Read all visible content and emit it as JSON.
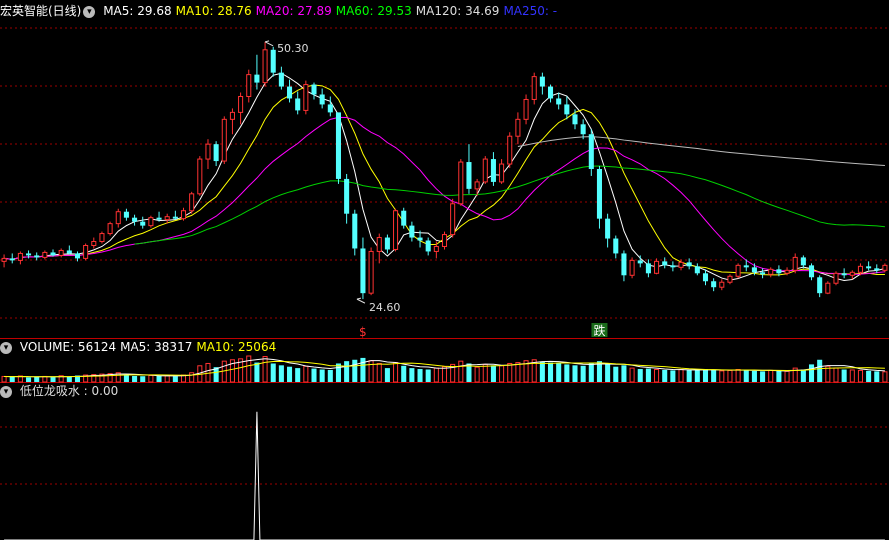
{
  "stock": {
    "title": "宏英智能(日线)"
  },
  "price_panel": {
    "indicators": [
      {
        "label": "MA5: 29.68",
        "color": "#ffffff"
      },
      {
        "label": "MA10: 28.76",
        "color": "#ffff00"
      },
      {
        "label": "MA20: 27.89",
        "color": "#ff00ff"
      },
      {
        "label": "MA60: 29.53",
        "color": "#00ff00"
      },
      {
        "label": "MA120: 34.69",
        "color": "#dddddd"
      },
      {
        "label": "MA250: -",
        "color": "#3333ff"
      }
    ],
    "high_marker": "50.30",
    "low_marker": "24.60",
    "signal_buy": "$",
    "signal_fall": "跌"
  },
  "volume_panel": {
    "indicators": [
      {
        "label": "VOLUME: 56124",
        "color": "#ffffff"
      },
      {
        "label": "MA5: 38317",
        "color": "#ffffff"
      },
      {
        "label": "MA10: 25064",
        "color": "#ffff00"
      }
    ]
  },
  "signal_panel": {
    "indicators": [
      {
        "label": "低位龙吸水 : 0.00",
        "color": "#dddddd"
      }
    ]
  },
  "colors": {
    "up": "#ff3232",
    "down": "#54ffff",
    "grid": "#9b0000"
  },
  "chart_data": {
    "type": "candlestick",
    "ohlc": [
      [
        28.2,
        28.9,
        27.6,
        28.5
      ],
      [
        28.5,
        29.0,
        28.0,
        28.3
      ],
      [
        28.3,
        29.2,
        27.9,
        29.0
      ],
      [
        29.0,
        29.3,
        28.5,
        28.8
      ],
      [
        28.8,
        29.1,
        28.3,
        28.6
      ],
      [
        28.6,
        29.3,
        28.4,
        29.1
      ],
      [
        29.1,
        29.4,
        28.7,
        28.8
      ],
      [
        28.8,
        29.5,
        28.6,
        29.3
      ],
      [
        29.3,
        29.8,
        28.9,
        29.0
      ],
      [
        29.0,
        29.2,
        28.2,
        28.5
      ],
      [
        28.5,
        30.0,
        28.3,
        29.8
      ],
      [
        29.8,
        30.6,
        29.5,
        30.2
      ],
      [
        30.2,
        31.2,
        30.0,
        31.0
      ],
      [
        31.0,
        32.2,
        30.8,
        32.0
      ],
      [
        32.0,
        33.5,
        31.6,
        33.2
      ],
      [
        33.2,
        33.5,
        32.3,
        32.6
      ],
      [
        32.6,
        32.9,
        31.8,
        32.2
      ],
      [
        32.2,
        32.7,
        31.5,
        31.8
      ],
      [
        31.8,
        32.8,
        31.6,
        32.6
      ],
      [
        32.6,
        33.2,
        32.2,
        32.4
      ],
      [
        32.4,
        33.0,
        32.0,
        32.7
      ],
      [
        32.7,
        33.3,
        32.4,
        32.5
      ],
      [
        32.5,
        33.6,
        32.3,
        33.3
      ],
      [
        33.3,
        35.2,
        33.0,
        35.0
      ],
      [
        35.0,
        38.8,
        34.8,
        38.5
      ],
      [
        38.5,
        40.5,
        37.5,
        40.0
      ],
      [
        40.0,
        40.3,
        37.8,
        38.3
      ],
      [
        38.3,
        42.8,
        38.0,
        42.5
      ],
      [
        42.5,
        43.6,
        41.0,
        43.2
      ],
      [
        43.2,
        45.2,
        42.0,
        44.8
      ],
      [
        44.8,
        47.5,
        44.2,
        47.0
      ],
      [
        47.0,
        49.0,
        45.5,
        46.2
      ],
      [
        46.2,
        50.3,
        45.8,
        49.5
      ],
      [
        49.5,
        49.8,
        46.8,
        47.2
      ],
      [
        47.2,
        47.8,
        45.5,
        45.8
      ],
      [
        45.8,
        46.5,
        44.2,
        44.6
      ],
      [
        44.6,
        45.3,
        43.0,
        43.4
      ],
      [
        43.4,
        46.4,
        43.0,
        46.0
      ],
      [
        46.0,
        46.2,
        44.5,
        45.0
      ],
      [
        45.0,
        45.6,
        43.6,
        44.0
      ],
      [
        44.0,
        44.8,
        42.8,
        43.2
      ],
      [
        43.2,
        39.5,
        36.0,
        36.5
      ],
      [
        36.5,
        37.0,
        32.0,
        33.0
      ],
      [
        33.0,
        33.4,
        28.8,
        29.5
      ],
      [
        29.5,
        30.6,
        24.4,
        25.0
      ],
      [
        25.0,
        29.6,
        24.8,
        29.2
      ],
      [
        29.2,
        31.0,
        28.0,
        30.6
      ],
      [
        30.6,
        30.9,
        29.0,
        29.4
      ],
      [
        29.4,
        33.5,
        29.2,
        33.3
      ],
      [
        33.3,
        33.6,
        31.5,
        31.8
      ],
      [
        31.8,
        32.2,
        30.2,
        30.6
      ],
      [
        30.6,
        31.3,
        29.6,
        30.3
      ],
      [
        30.3,
        30.6,
        28.8,
        29.2
      ],
      [
        29.2,
        30.2,
        28.5,
        29.7
      ],
      [
        29.7,
        31.2,
        29.4,
        30.9
      ],
      [
        30.9,
        34.5,
        30.6,
        34.0
      ],
      [
        34.0,
        38.5,
        33.8,
        38.2
      ],
      [
        38.2,
        40.0,
        35.0,
        35.5
      ],
      [
        35.5,
        36.5,
        34.8,
        36.2
      ],
      [
        36.2,
        38.8,
        36.0,
        38.5
      ],
      [
        38.5,
        39.2,
        35.8,
        36.2
      ],
      [
        36.2,
        38.5,
        36.0,
        38.0
      ],
      [
        38.0,
        41.2,
        37.6,
        40.8
      ],
      [
        40.8,
        43.2,
        40.0,
        42.5
      ],
      [
        42.5,
        45.0,
        42.0,
        44.5
      ],
      [
        44.5,
        47.2,
        44.0,
        46.8
      ],
      [
        46.8,
        47.2,
        45.0,
        45.8
      ],
      [
        45.8,
        46.0,
        44.2,
        44.6
      ],
      [
        44.6,
        45.2,
        43.5,
        44.0
      ],
      [
        44.0,
        44.8,
        42.5,
        43.0
      ],
      [
        43.0,
        43.5,
        41.5,
        42.0
      ],
      [
        42.0,
        42.5,
        40.5,
        41.0
      ],
      [
        41.0,
        41.5,
        36.8,
        37.5
      ],
      [
        37.5,
        37.8,
        31.5,
        32.5
      ],
      [
        32.5,
        33.0,
        29.6,
        30.5
      ],
      [
        30.5,
        30.8,
        28.5,
        29.0
      ],
      [
        29.0,
        29.3,
        26.2,
        26.8
      ],
      [
        26.8,
        28.6,
        26.5,
        28.3
      ],
      [
        28.3,
        28.8,
        27.6,
        28.0
      ],
      [
        28.0,
        28.4,
        26.6,
        27.0
      ],
      [
        27.0,
        28.5,
        26.9,
        28.2
      ],
      [
        28.2,
        28.6,
        27.5,
        27.8
      ],
      [
        27.8,
        28.2,
        27.2,
        27.6
      ],
      [
        27.6,
        28.4,
        27.3,
        28.1
      ],
      [
        28.1,
        28.5,
        27.4,
        27.7
      ],
      [
        27.7,
        28.0,
        26.8,
        27.0
      ],
      [
        27.0,
        27.4,
        25.8,
        26.2
      ],
      [
        26.2,
        26.5,
        25.2,
        25.6
      ],
      [
        25.6,
        26.4,
        25.3,
        26.1
      ],
      [
        26.1,
        26.9,
        25.9,
        26.7
      ],
      [
        26.7,
        28.0,
        26.5,
        27.8
      ],
      [
        27.8,
        28.4,
        27.2,
        27.6
      ],
      [
        27.6,
        28.0,
        26.8,
        27.1
      ],
      [
        27.1,
        27.5,
        26.5,
        26.9
      ],
      [
        26.9,
        27.6,
        26.6,
        27.4
      ],
      [
        27.4,
        27.8,
        26.7,
        27.0
      ],
      [
        27.0,
        27.6,
        26.8,
        27.3
      ],
      [
        27.3,
        29.0,
        27.0,
        28.6
      ],
      [
        28.6,
        28.8,
        27.5,
        27.8
      ],
      [
        27.8,
        28.0,
        26.3,
        26.6
      ],
      [
        26.6,
        26.8,
        24.6,
        25.0
      ],
      [
        25.0,
        26.2,
        24.9,
        26.0
      ],
      [
        26.0,
        27.2,
        25.8,
        27.0
      ],
      [
        27.0,
        27.5,
        26.5,
        26.8
      ],
      [
        26.8,
        27.3,
        26.4,
        27.1
      ],
      [
        27.1,
        28.0,
        26.8,
        27.7
      ],
      [
        27.7,
        28.2,
        27.3,
        27.5
      ],
      [
        27.5,
        27.9,
        27.0,
        27.3
      ],
      [
        27.3,
        28.0,
        27.1,
        27.8
      ]
    ],
    "volume": [
      12000,
      11000,
      13000,
      10000,
      11000,
      12000,
      10500,
      13500,
      11000,
      14000,
      15000,
      16000,
      17000,
      18000,
      20000,
      15000,
      13000,
      12500,
      14000,
      13000,
      13500,
      12500,
      15000,
      20000,
      35000,
      40000,
      32000,
      45000,
      48000,
      50000,
      56124,
      42000,
      55000,
      40000,
      36000,
      33000,
      30000,
      34000,
      29000,
      27000,
      26000,
      40000,
      45000,
      48000,
      52000,
      46000,
      40000,
      30000,
      42000,
      35000,
      30000,
      28000,
      27000,
      30000,
      33000,
      38000,
      45000,
      40000,
      32000,
      38000,
      36000,
      35000,
      40000,
      42000,
      46000,
      48000,
      44000,
      42000,
      40000,
      38000,
      36000,
      35000,
      40000,
      45000,
      38000,
      33000,
      36000,
      30000,
      28000,
      29000,
      27000,
      26000,
      25000,
      27000,
      26000,
      25000,
      28000,
      26000,
      24000,
      25000,
      27000,
      26000,
      24000,
      23000,
      25000,
      24000,
      23000,
      30000,
      27000,
      38000,
      48000,
      34000,
      30000,
      27000,
      26000,
      25000,
      24000,
      23000,
      22000
    ],
    "signal": {
      "spike_index": 31,
      "spike_value": 1.0
    },
    "price_range": [
      22.5,
      52.5
    ],
    "signal_range": [
      0,
      1.1
    ]
  }
}
